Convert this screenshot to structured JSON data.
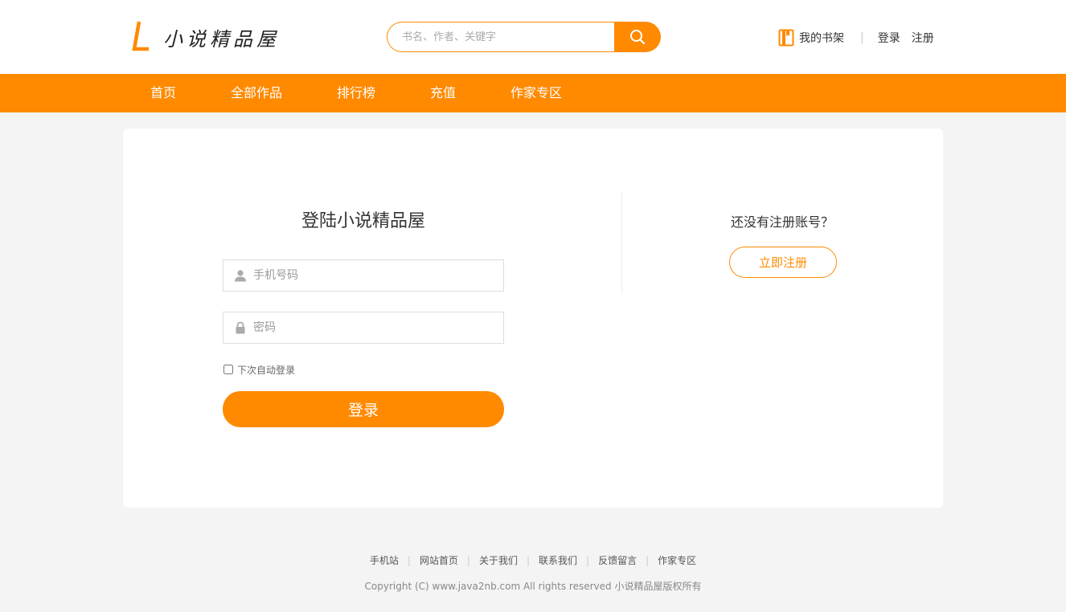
{
  "header": {
    "logo_text": "小说精品屋",
    "search_placeholder": "书名、作者、关键字",
    "bookshelf_label": "我的书架",
    "separator": "|",
    "login_label": "登录",
    "register_label": "注册"
  },
  "nav": {
    "items": [
      "首页",
      "全部作品",
      "排行榜",
      "充值",
      "作家专区"
    ]
  },
  "login": {
    "title": "登陆小说精品屋",
    "phone_placeholder": "手机号码",
    "password_placeholder": "密码",
    "remember_label": "下次自动登录",
    "remember_checked": false,
    "submit_label": "登录"
  },
  "register": {
    "tip": "还没有注册账号？",
    "button_label": "立即注册"
  },
  "footer": {
    "links": [
      "手机站",
      "网站首页",
      "关于我们",
      "联系我们",
      "反馈留言",
      "作家专区"
    ],
    "separator": "|",
    "copyright": "Copyright (C) www.java2nb.com All rights reserved  小说精品屋版权所有"
  },
  "colors": {
    "accent": "#ff8a00",
    "background": "#f4f4f4",
    "card": "#ffffff"
  },
  "icons": [
    "logo-mark-icon",
    "search-icon",
    "bookshelf-icon",
    "user-icon",
    "lock-icon"
  ]
}
